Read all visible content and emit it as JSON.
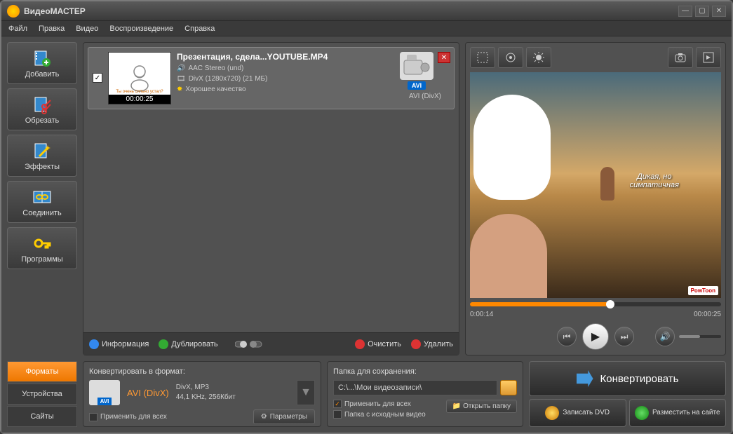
{
  "app": {
    "title": "ВидеоМАСТЕР"
  },
  "menu": [
    "Файл",
    "Правка",
    "Видео",
    "Воспроизведение",
    "Справка"
  ],
  "sidebar": [
    {
      "label": "Добавить",
      "icon": "film-plus"
    },
    {
      "label": "Обрезать",
      "icon": "scissors"
    },
    {
      "label": "Эффекты",
      "icon": "wand"
    },
    {
      "label": "Соединить",
      "icon": "link"
    },
    {
      "label": "Программы",
      "icon": "key"
    }
  ],
  "file": {
    "name": "Презентация, сдела...YOUTUBE.MP4",
    "duration": "00:00:25",
    "audio": "AAC Stereo (und)",
    "video": "DivX (1280x720) (21 МБ)",
    "quality": "Хорошее качество",
    "target_badge": "AVI",
    "target_text": "AVI (DivX)",
    "checked": "✓",
    "thumb_caption": "Ты очень сильно устал?"
  },
  "list_toolbar": {
    "info": "Информация",
    "dup": "Дублировать",
    "clear": "Очистить",
    "del": "Удалить"
  },
  "preview": {
    "current": "0:00:14",
    "total": "00:00:25",
    "overlay1": "Дикая, но",
    "overlay2": "симпатичная",
    "logo": "PowToon"
  },
  "tabs": {
    "formats": "Форматы",
    "devices": "Устройства",
    "sites": "Сайты"
  },
  "format": {
    "label": "Конвертировать в формат:",
    "name": "AVI (DivX)",
    "badge": "AVI",
    "codecs": "DivX, MP3",
    "params": "44,1 KHz, 256Кбит",
    "apply_all": "Применить для всех",
    "btn": "Параметры"
  },
  "save": {
    "label": "Папка для сохранения:",
    "path": "C:\\...\\Мои видеозаписи\\",
    "apply_all": "Применить для всех",
    "src_folder": "Папка с исходным видео",
    "open": "Открыть папку"
  },
  "actions": {
    "convert": "Конвертировать",
    "dvd": "Записать DVD",
    "web": "Разместить на сайте"
  }
}
